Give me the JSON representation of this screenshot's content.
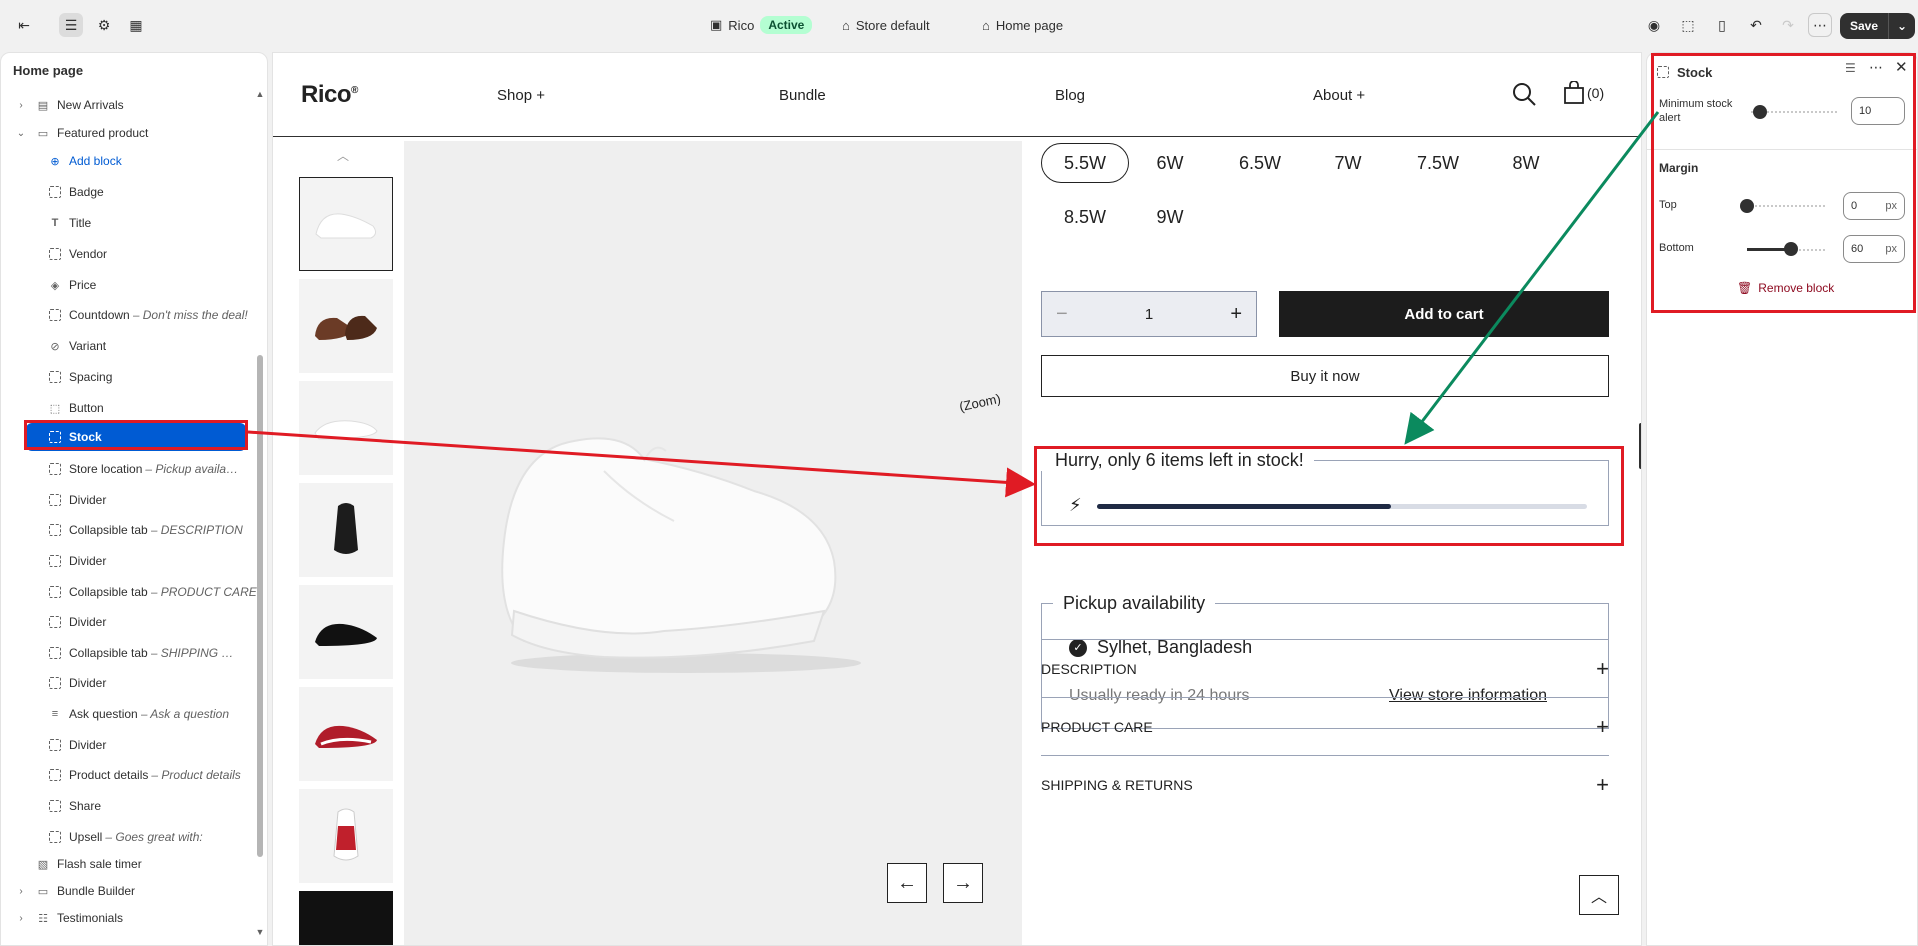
{
  "topbar": {
    "theme_name": "Rico",
    "theme_status": "Active",
    "store_label": "Store default",
    "page_label": "Home page",
    "save_label": "Save"
  },
  "left_panel": {
    "title": "Home page",
    "items": [
      {
        "label": "New Arrivals",
        "sub": ""
      },
      {
        "label": "Featured product",
        "sub": ""
      },
      {
        "label": "Add block",
        "sub": ""
      },
      {
        "label": "Badge",
        "sub": ""
      },
      {
        "label": "Title",
        "sub": ""
      },
      {
        "label": "Vendor",
        "sub": ""
      },
      {
        "label": "Price",
        "sub": ""
      },
      {
        "label": "Countdown",
        "sub": "– Don't miss the deal!"
      },
      {
        "label": "Variant",
        "sub": ""
      },
      {
        "label": "Spacing",
        "sub": ""
      },
      {
        "label": "Button",
        "sub": ""
      },
      {
        "label": "Stock",
        "sub": ""
      },
      {
        "label": "Store location",
        "sub": "– Pickup availabili..."
      },
      {
        "label": "Divider",
        "sub": ""
      },
      {
        "label": "Collapsible tab",
        "sub": "– DESCRIPTION"
      },
      {
        "label": "Divider",
        "sub": ""
      },
      {
        "label": "Collapsible tab",
        "sub": "– PRODUCT CARE"
      },
      {
        "label": "Divider",
        "sub": ""
      },
      {
        "label": "Collapsible tab",
        "sub": "– SHIPPING & R..."
      },
      {
        "label": "Divider",
        "sub": ""
      },
      {
        "label": "Ask question",
        "sub": "– Ask a question"
      },
      {
        "label": "Divider",
        "sub": ""
      },
      {
        "label": "Product details",
        "sub": "– Product details"
      },
      {
        "label": "Share",
        "sub": ""
      },
      {
        "label": "Upsell",
        "sub": "– Goes great with:"
      },
      {
        "label": "Flash sale timer",
        "sub": ""
      },
      {
        "label": "Bundle Builder",
        "sub": ""
      },
      {
        "label": "Testimonials",
        "sub": ""
      }
    ]
  },
  "store": {
    "logo": "Rico",
    "logo_mark": "®",
    "nav": [
      "Shop +",
      "Bundle",
      "Blog",
      "About +"
    ],
    "cart_count": "(0)",
    "zoom_label": "(Zoom)",
    "sizes_row1": [
      "5.5W",
      "6W",
      "6.5W",
      "7W",
      "7.5W",
      "8W"
    ],
    "sizes_row2": [
      "8.5W",
      "9W"
    ],
    "quantity": "1",
    "add_to_cart": "Add to cart",
    "buy_now": "Buy it now",
    "stock_text": "Hurry, only 6 items left in stock!",
    "stock_fill_fraction": 0.6,
    "pickup_title": "Pickup availability",
    "pickup_location": "Sylhet, Bangladesh",
    "pickup_ready": "Usually ready in 24 hours",
    "pickup_link": "View store information",
    "accordions": [
      "DESCRIPTION",
      "PRODUCT CARE",
      "SHIPPING & RETURNS"
    ]
  },
  "right_panel": {
    "title": "Stock",
    "min_stock_label": "Minimum stock alert",
    "min_stock_value": "10",
    "min_stock_fraction": 0.1,
    "margin_title": "Margin",
    "top_label": "Top",
    "top_value": "0",
    "top_fraction": 0,
    "bottom_label": "Bottom",
    "bottom_value": "60",
    "bottom_fraction": 0.55,
    "unit": "px",
    "remove_label": "Remove block"
  },
  "colors": {
    "accent": "#005bd3",
    "annotation_red": "#e01b24",
    "annotation_green": "#0b8a5e"
  }
}
